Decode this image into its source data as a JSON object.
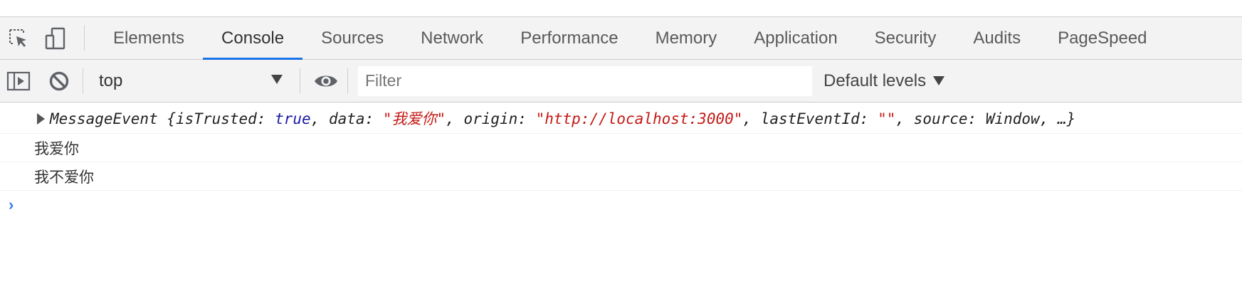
{
  "tabs": [
    {
      "label": "Elements",
      "active": false
    },
    {
      "label": "Console",
      "active": true
    },
    {
      "label": "Sources",
      "active": false
    },
    {
      "label": "Network",
      "active": false
    },
    {
      "label": "Performance",
      "active": false
    },
    {
      "label": "Memory",
      "active": false
    },
    {
      "label": "Application",
      "active": false
    },
    {
      "label": "Security",
      "active": false
    },
    {
      "label": "Audits",
      "active": false
    },
    {
      "label": "PageSpeed",
      "active": false
    }
  ],
  "toolbar": {
    "context": "top",
    "filter_placeholder": "Filter",
    "levels": "Default levels"
  },
  "messages": {
    "event": {
      "name": "MessageEvent",
      "k1": "isTrusted",
      "v1": "true",
      "k2": "data",
      "v2": "\"我爱你\"",
      "k3": "origin",
      "v3": "\"http://localhost:3000\"",
      "k4": "lastEventId",
      "v4": "\"\"",
      "k5": "source",
      "v5": "Window",
      "tail": "…}"
    },
    "log1": "我爱你",
    "log2": "我不爱你"
  },
  "prompt_symbol": "›",
  "colors": {
    "accent": "#1a73e8",
    "keyword": "#1a1aa6",
    "string": "#c41a16",
    "prompt": "#367cf1"
  }
}
